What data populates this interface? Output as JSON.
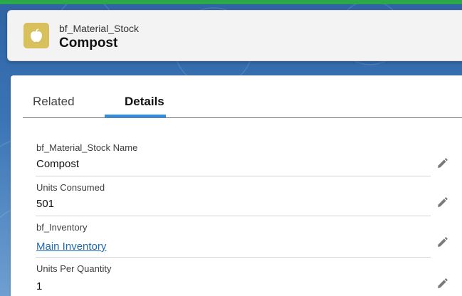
{
  "colors": {
    "top_accent": "#2aa84a",
    "background": "#3a74b6",
    "icon_bg": "#d8c05d",
    "active_tab": "#2c8fe8",
    "link": "#1c6bb8"
  },
  "header": {
    "icon": "apple-icon",
    "record_type": "bf_Material_Stock",
    "record_name": "Compost"
  },
  "tabs": [
    {
      "label": "Related",
      "active": false
    },
    {
      "label": "Details",
      "active": true
    }
  ],
  "fields": [
    {
      "label": "bf_Material_Stock Name",
      "value": "Compost",
      "is_link": false,
      "edit_icon": "pencil-icon"
    },
    {
      "label": "Units Consumed",
      "value": "501",
      "is_link": false,
      "edit_icon": "pencil-icon"
    },
    {
      "label": "bf_Inventory",
      "value": "Main Inventory",
      "is_link": true,
      "edit_icon": "pencil-icon"
    },
    {
      "label": "Units Per Quantity",
      "value": "1",
      "is_link": false,
      "edit_icon": "pencil-icon"
    }
  ]
}
